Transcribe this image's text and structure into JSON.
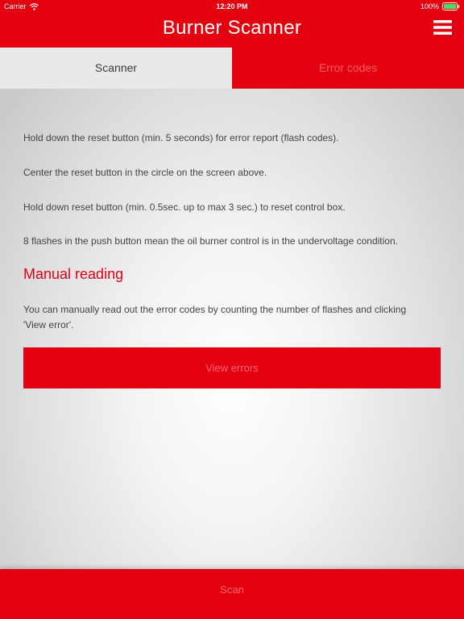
{
  "status_bar": {
    "carrier": "Carrier",
    "time": "12:20 PM",
    "battery": "100%",
    "wifi_icon": "wifi-icon",
    "battery_icon": "battery-icon"
  },
  "header": {
    "title": "Burner Scanner",
    "menu_icon": "hamburger-menu-icon"
  },
  "tabs": [
    {
      "label": "Scanner",
      "active": true
    },
    {
      "label": "Error codes",
      "active": false
    }
  ],
  "instructions": [
    "Hold down the reset button (min. 5 seconds) for error report (flash codes).",
    "Center the reset button in the circle on the screen above.",
    "Hold down reset button (min. 0.5sec. up to max 3 sec.) to reset control box.",
    "8 flashes in the push button mean the oil burner control is in the undervoltage condition."
  ],
  "manual": {
    "heading": "Manual reading",
    "text": "You can manually read out the error codes by counting the number of flashes and clicking 'View error'.",
    "button_label": "View errors"
  },
  "bottom": {
    "scan_label": "Scan"
  },
  "colors": {
    "brand_red": "#e3000f",
    "dim_button_text": "#ff6a73",
    "body_text": "#444444"
  }
}
